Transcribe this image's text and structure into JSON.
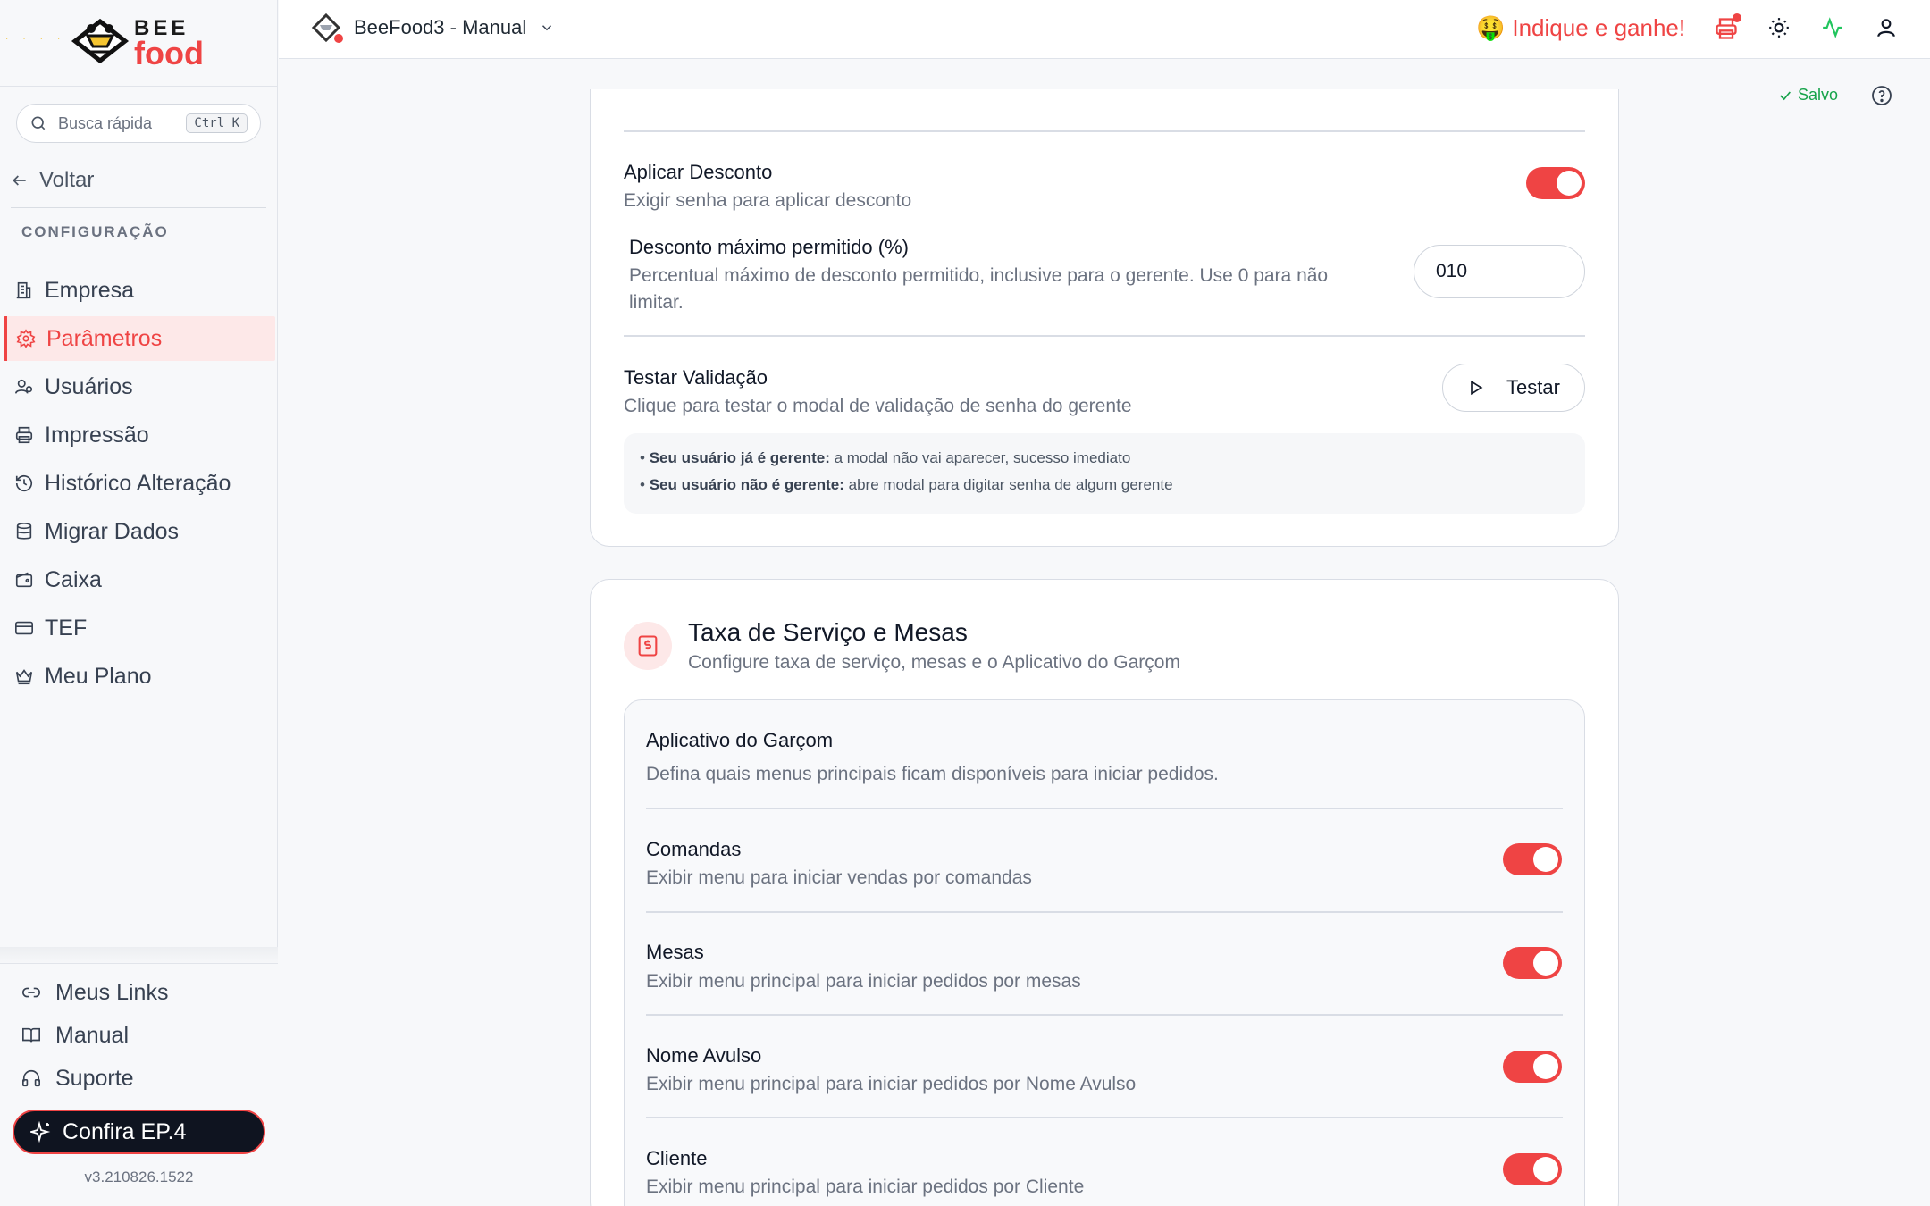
{
  "brand": {
    "line1": "BEE",
    "line2": "food",
    "accent": "#ef4444"
  },
  "search": {
    "placeholder": "Busca rápida",
    "shortcut": "Ctrl K"
  },
  "sidebar": {
    "back_label": "Voltar",
    "section_label": "CONFIGURAÇÃO",
    "items": [
      {
        "label": "Empresa",
        "icon": "building-icon",
        "active": false
      },
      {
        "label": "Parâmetros",
        "icon": "gear-icon",
        "active": true
      },
      {
        "label": "Usuários",
        "icon": "users-icon",
        "active": false
      },
      {
        "label": "Impressão",
        "icon": "printer-icon",
        "active": false
      },
      {
        "label": "Histórico Alteração",
        "icon": "history-icon",
        "active": false
      },
      {
        "label": "Migrar Dados",
        "icon": "database-icon",
        "active": false
      },
      {
        "label": "Caixa",
        "icon": "wallet-icon",
        "active": false
      },
      {
        "label": "TEF",
        "icon": "card-icon",
        "active": false
      },
      {
        "label": "Meu Plano",
        "icon": "crown-icon",
        "active": false
      }
    ],
    "bottom_links": [
      {
        "label": "Meus Links",
        "icon": "link-icon"
      },
      {
        "label": "Manual",
        "icon": "book-icon"
      },
      {
        "label": "Suporte",
        "icon": "headset-icon"
      }
    ],
    "cta_label": "Confira EP.4",
    "version": "v3.210826.1522"
  },
  "header": {
    "company": "BeeFood3 - Manual",
    "referral": "Indique e ganhe!",
    "referral_emoji": "🤑",
    "icons": [
      "printer-alert-icon",
      "sun-icon",
      "activity-icon",
      "user-icon"
    ]
  },
  "status": {
    "saved": "Salvo"
  },
  "discount_card": {
    "apply": {
      "title": "Aplicar Desconto",
      "desc": "Exigir senha para aplicar desconto",
      "enabled": true
    },
    "max": {
      "title": "Desconto máximo permitido (%)",
      "desc": "Percentual máximo de desconto permitido, inclusive para o gerente. Use 0 para não limitar.",
      "value": "010"
    },
    "test": {
      "title": "Testar Validação",
      "desc": "Clique para testar o modal de validação de senha do gerente",
      "button": "Testar"
    },
    "info": [
      {
        "bold": "Seu usuário já é gerente:",
        "text": " a modal não vai aparecer, sucesso imediato"
      },
      {
        "bold": "Seu usuário não é gerente:",
        "text": " abre modal para digitar senha de algum gerente"
      }
    ]
  },
  "service_card": {
    "title": "Taxa de Serviço e Mesas",
    "subtitle": "Configure taxa de serviço, mesas e o Aplicativo do Garçom",
    "app": {
      "title": "Aplicativo do Garçom",
      "desc": "Defina quais menus principais ficam disponíveis para iniciar pedidos."
    },
    "rows": [
      {
        "title": "Comandas",
        "desc": "Exibir menu para iniciar vendas por comandas",
        "enabled": true
      },
      {
        "title": "Mesas",
        "desc": "Exibir menu principal para iniciar pedidos por mesas",
        "enabled": true
      },
      {
        "title": "Nome Avulso",
        "desc": "Exibir menu principal para iniciar pedidos por Nome Avulso",
        "enabled": true
      },
      {
        "title": "Cliente",
        "desc": "Exibir menu principal para iniciar pedidos por Cliente",
        "enabled": true
      }
    ]
  }
}
